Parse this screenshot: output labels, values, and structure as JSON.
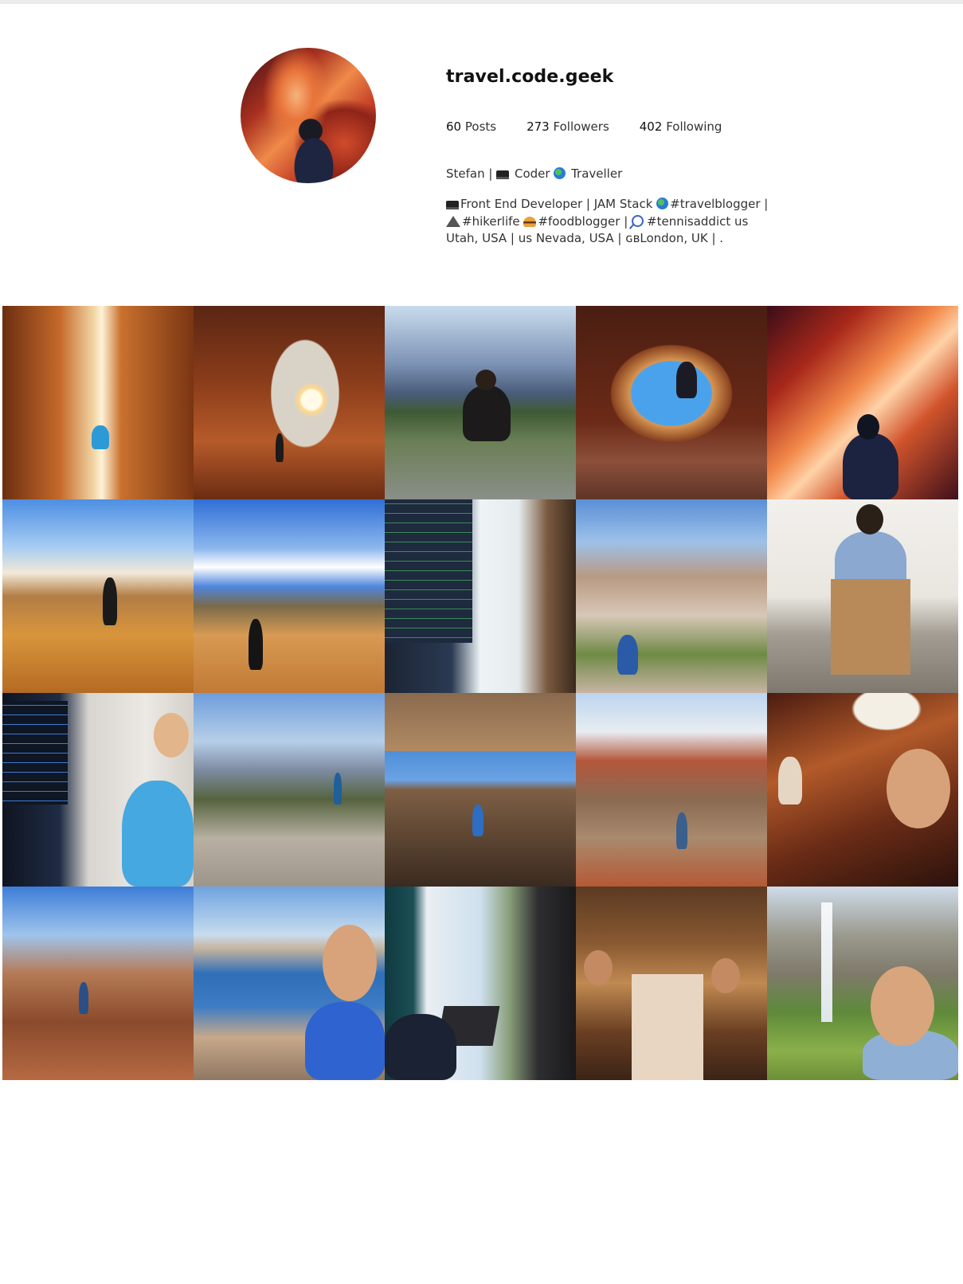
{
  "profile": {
    "username": "travel.code.geek",
    "avatar_icon": "profile-avatar-canyon",
    "stats": {
      "posts_count": "60",
      "posts_label": "Posts",
      "followers_count": "273",
      "followers_label": "Followers",
      "following_count": "402",
      "following_label": "Following"
    },
    "bio_name_a": "Stefan | ",
    "bio_name_b": " Coder ",
    "bio_name_c": " Traveller",
    "bio_line1_a": "Front End Developer | JAM Stack ",
    "bio_line1_b": "#travelblogger |",
    "bio_line2_a": "#hikerlife ",
    "bio_line2_b": "#foodblogger | ",
    "bio_line2_c": "#tennisaddict us",
    "bio_line3": "Utah, USA | us Nevada, USA | ɢʙLondon, UK | ."
  },
  "grid": {
    "columns": 5,
    "rows": 4,
    "photos": [
      {
        "name": "photo-canyon-climb"
      },
      {
        "name": "photo-rock-arch-sunset"
      },
      {
        "name": "photo-canyon-overlook-sitting"
      },
      {
        "name": "photo-cave-jump"
      },
      {
        "name": "photo-antelope-canyon"
      },
      {
        "name": "photo-sand-dunes-walk"
      },
      {
        "name": "photo-sand-dunes-standing"
      },
      {
        "name": "photo-code-monitor"
      },
      {
        "name": "photo-canyon-hike"
      },
      {
        "name": "photo-computer-unboxing"
      },
      {
        "name": "photo-desk-coding"
      },
      {
        "name": "photo-mountain-vista"
      },
      {
        "name": "photo-rock-wall"
      },
      {
        "name": "photo-red-rock-valley"
      },
      {
        "name": "photo-cave-selfie"
      },
      {
        "name": "photo-red-rocks-summit"
      },
      {
        "name": "photo-lake-selfie"
      },
      {
        "name": "photo-window-laptop"
      },
      {
        "name": "photo-group-dinner"
      },
      {
        "name": "photo-waterfall-selfie"
      }
    ]
  }
}
